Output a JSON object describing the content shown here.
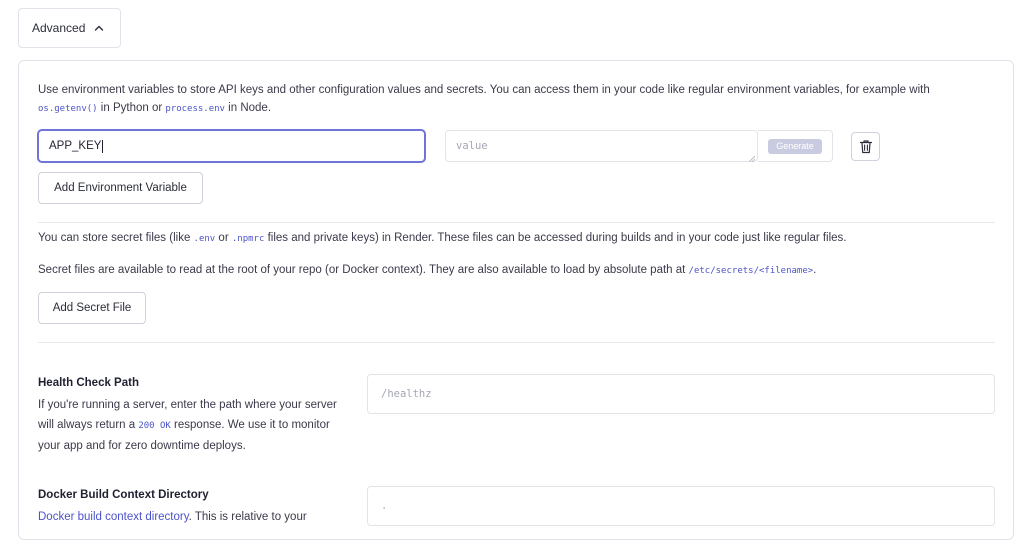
{
  "advanced": {
    "label": "Advanced"
  },
  "env": {
    "intro_pre": "Use environment variables to store API keys and other configuration values and secrets. You can access them in your code like regular environment variables, for example with",
    "intro_code1": "os.getenv()",
    "intro_mid": " in Python or ",
    "intro_code2": "process.env",
    "intro_post": " in Node.",
    "key_value": "APP_KEY",
    "value_placeholder": "value",
    "generate_label": "Generate",
    "add_button": "Add Environment Variable"
  },
  "secrets": {
    "line1_pre": "You can store secret files (like ",
    "line1_code1": ".env",
    "line1_mid": " or ",
    "line1_code2": ".npmrc",
    "line1_post": " files and private keys) in Render. These files can be accessed during builds and in your code just like regular files.",
    "line2_pre": "Secret files are available to read at the root of your repo (or Docker context). They are also available to load by absolute path at ",
    "line2_code": "/etc/secrets/<filename>",
    "line2_post": ".",
    "add_button": "Add Secret File"
  },
  "health": {
    "title": "Health Check Path",
    "desc_pre": "If you're running a server, enter the path where your server will always return a ",
    "desc_code": "200 OK",
    "desc_post": " response. We use it to monitor your app and for zero downtime deploys.",
    "placeholder": "/healthz"
  },
  "docker": {
    "title": "Docker Build Context Directory",
    "desc_link": "Docker build context directory",
    "desc_post": ". This is relative to your",
    "placeholder": "."
  }
}
